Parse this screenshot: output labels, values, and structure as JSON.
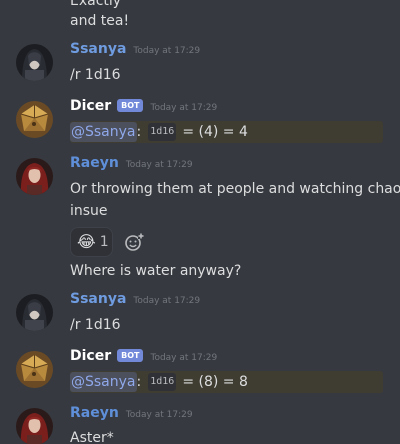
{
  "messages": {
    "prev_tail": {
      "line1": "Exactly",
      "line2": "and tea!"
    },
    "m1": {
      "author": "Ssanya",
      "timestamp": "Today at 17:29",
      "text": "/r 1d16"
    },
    "m2": {
      "author": "Dicer",
      "badge": "BOT",
      "timestamp": "Today at 17:29",
      "mention": "@Ssanya",
      "colon": ":",
      "code": "1d16",
      "result": "= (4) = 4"
    },
    "m3": {
      "author": "Raeyn",
      "timestamp": "Today at 17:29",
      "line1": "Or throwing them at people and watching chaos",
      "line2": "insue",
      "reaction": {
        "emoji": "😂",
        "count": "1"
      },
      "followup": "Where is water anyway?"
    },
    "m4": {
      "author": "Ssanya",
      "timestamp": "Today at 17:29",
      "text": "/r 1d16"
    },
    "m5": {
      "author": "Dicer",
      "badge": "BOT",
      "timestamp": "Today at 17:29",
      "mention": "@Ssanya",
      "colon": ":",
      "code": "1d16",
      "result": "= (8) = 8"
    },
    "m6": {
      "author": "Raeyn",
      "timestamp": "Today at 17:29",
      "text": "Aster*"
    }
  },
  "colors": {
    "background": "#36393f",
    "username_blue": "#6f9ce0",
    "bot_badge": "#7289da",
    "mention": "#8fa8ea",
    "dice_highlight": "#3f3d32"
  },
  "icons": {
    "avatar_ssanya": "hooded-figure-avatar",
    "avatar_dicer": "dice-avatar",
    "avatar_raeyn": "red-haired-avatar",
    "add_reaction": "add-reaction-icon"
  }
}
